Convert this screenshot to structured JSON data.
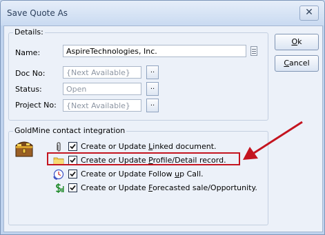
{
  "window": {
    "title": "Save Quote As",
    "close_glyph": "✕"
  },
  "details": {
    "group_label": "Details:",
    "name": {
      "label": "Name:",
      "value": "AspireTechnologies, Inc."
    },
    "doc_no": {
      "label": "Doc No:",
      "value": "{Next Available}"
    },
    "status": {
      "label": "Status:",
      "value": "Open"
    },
    "project_no": {
      "label": "Project No:",
      "value": "{Next Available}"
    },
    "browse_glyph": ".."
  },
  "buttons": {
    "ok": {
      "prefix": "",
      "accel": "O",
      "suffix": "k"
    },
    "cancel": {
      "prefix": "",
      "accel": "C",
      "suffix": "ancel"
    }
  },
  "integration": {
    "group_label": "GoldMine contact integration",
    "options": [
      {
        "icon": "paperclip-icon",
        "checked": true,
        "text_before": "Create or Update ",
        "accel": "L",
        "text_after": "inked document."
      },
      {
        "icon": "folder-icon",
        "checked": true,
        "text_before": "Create or Update ",
        "accel": "P",
        "text_after": "rofile/Detail record."
      },
      {
        "icon": "phone-clock-icon",
        "checked": true,
        "text_before": "Create or Update Follow ",
        "accel": "u",
        "text_after": "p Call."
      },
      {
        "icon": "dollar-sign-icon",
        "checked": true,
        "text_before": "Create or Update ",
        "accel": "F",
        "text_after": "orecasted sale/Opportunity."
      }
    ]
  },
  "annotation": {
    "color": "#c4141f",
    "highlighted_option": 1
  }
}
